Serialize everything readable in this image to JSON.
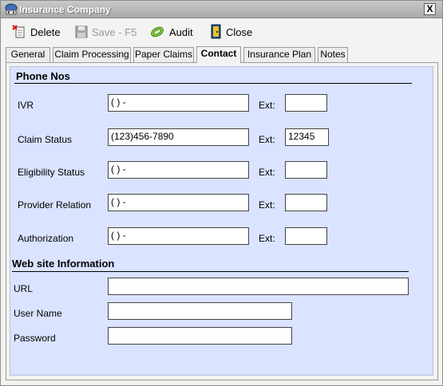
{
  "window": {
    "title": "Insurance Company",
    "close_label": "X"
  },
  "toolbar": {
    "delete_label": "Delete",
    "save_label": "Save - F5",
    "audit_label": "Audit",
    "close_label": "Close"
  },
  "tabs": [
    {
      "label": "General",
      "active": false
    },
    {
      "label": "Claim Processing",
      "active": false
    },
    {
      "label": "Paper Claims",
      "active": false
    },
    {
      "label": "Contact",
      "active": true
    },
    {
      "label": "Insurance Plan",
      "active": false
    },
    {
      "label": "Notes",
      "active": false
    }
  ],
  "phone": {
    "section_title": "Phone Nos",
    "ext_label": "Ext:",
    "rows": [
      {
        "label": "IVR",
        "value": "(  )  -",
        "ext": ""
      },
      {
        "label": "Claim Status",
        "value": "(123)456-7890",
        "ext": "12345"
      },
      {
        "label": "Eligibility Status",
        "value": "(  )  -",
        "ext": ""
      },
      {
        "label": "Provider Relation",
        "value": "(  )  -",
        "ext": ""
      },
      {
        "label": "Authorization",
        "value": "(  )  -",
        "ext": ""
      }
    ]
  },
  "web": {
    "section_title": "Web site Information",
    "url_label": "URL",
    "url_value": "",
    "username_label": "User Name",
    "username_value": "",
    "password_label": "Password",
    "password_value": ""
  },
  "colors": {
    "panel_bg": "#dae3ff",
    "window_bg": "#f3f3f1"
  },
  "icons": [
    "app-icon",
    "delete-icon",
    "save-icon",
    "audit-icon",
    "close-door-icon"
  ]
}
